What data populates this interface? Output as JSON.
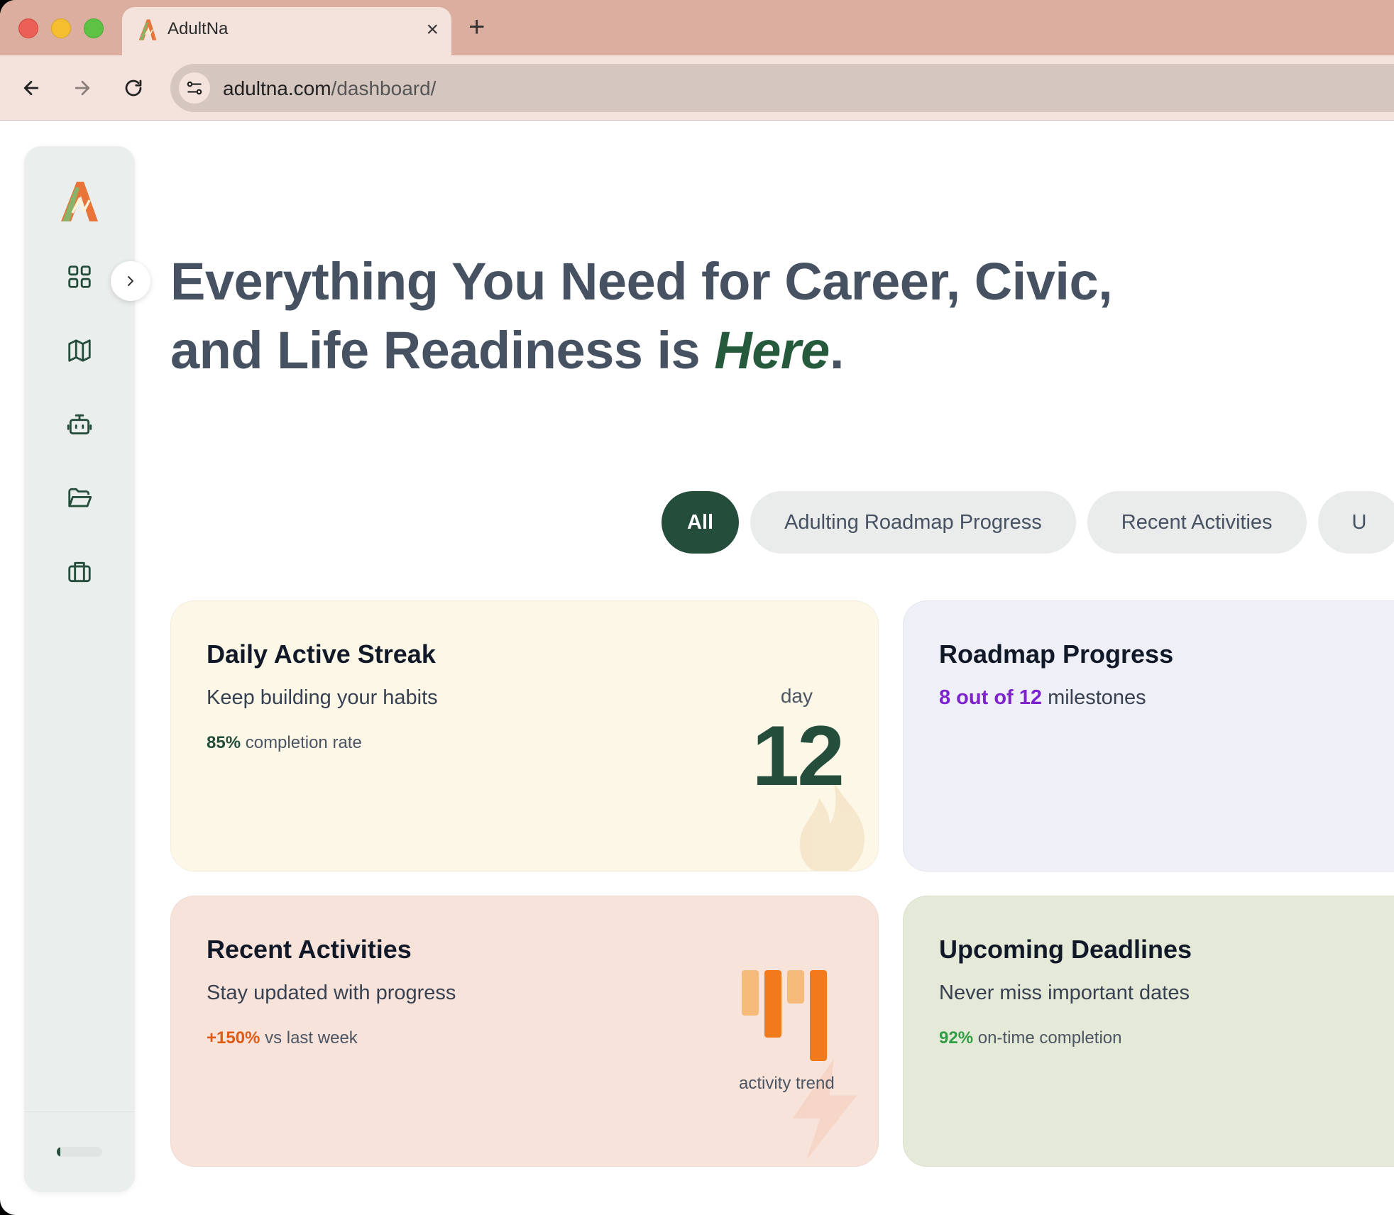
{
  "browser": {
    "tab_title": "AdultNa",
    "url_domain": "adultna.com",
    "url_path": "/dashboard/"
  },
  "sidebar": {
    "items": [
      {
        "icon": "grid-icon"
      },
      {
        "icon": "map-icon"
      },
      {
        "icon": "robot-icon"
      },
      {
        "icon": "folder-icon"
      },
      {
        "icon": "briefcase-icon"
      }
    ],
    "progress_fraction": 0.08
  },
  "hero": {
    "line1": "Everything You Need for Career, Civic,",
    "line2_prefix": "and Life Readiness is ",
    "line2_accent": "Here",
    "line2_suffix": "."
  },
  "filters": [
    "All",
    "Adulting Roadmap Progress",
    "Recent Activities",
    "U"
  ],
  "cards": {
    "streak": {
      "title": "Daily Active Streak",
      "subtitle": "Keep building your habits",
      "stat_value": "85%",
      "stat_text": " completion rate",
      "day_label": "day",
      "day_value": "12"
    },
    "roadmap": {
      "title": "Roadmap Progress",
      "stat_value": "8 out of 12",
      "stat_text": " milestones"
    },
    "activity": {
      "title": "Recent Activities",
      "subtitle": "Stay updated with progress",
      "stat_value": "+150%",
      "stat_text": " vs last week",
      "trend_label": "activity trend",
      "trend_bars": [
        0.5,
        0.74,
        0.37,
        1.0
      ]
    },
    "deadline": {
      "title": "Upcoming Deadlines",
      "subtitle": "Never miss important dates",
      "stat_value": "92%",
      "stat_text": " on-time completion"
    }
  },
  "colors": {
    "brand_green": "#254d3c",
    "accent_green": "#265a3c",
    "orange": "#f07a1c",
    "orange_light": "#f6bb7b",
    "purple": "#7e22ce"
  }
}
